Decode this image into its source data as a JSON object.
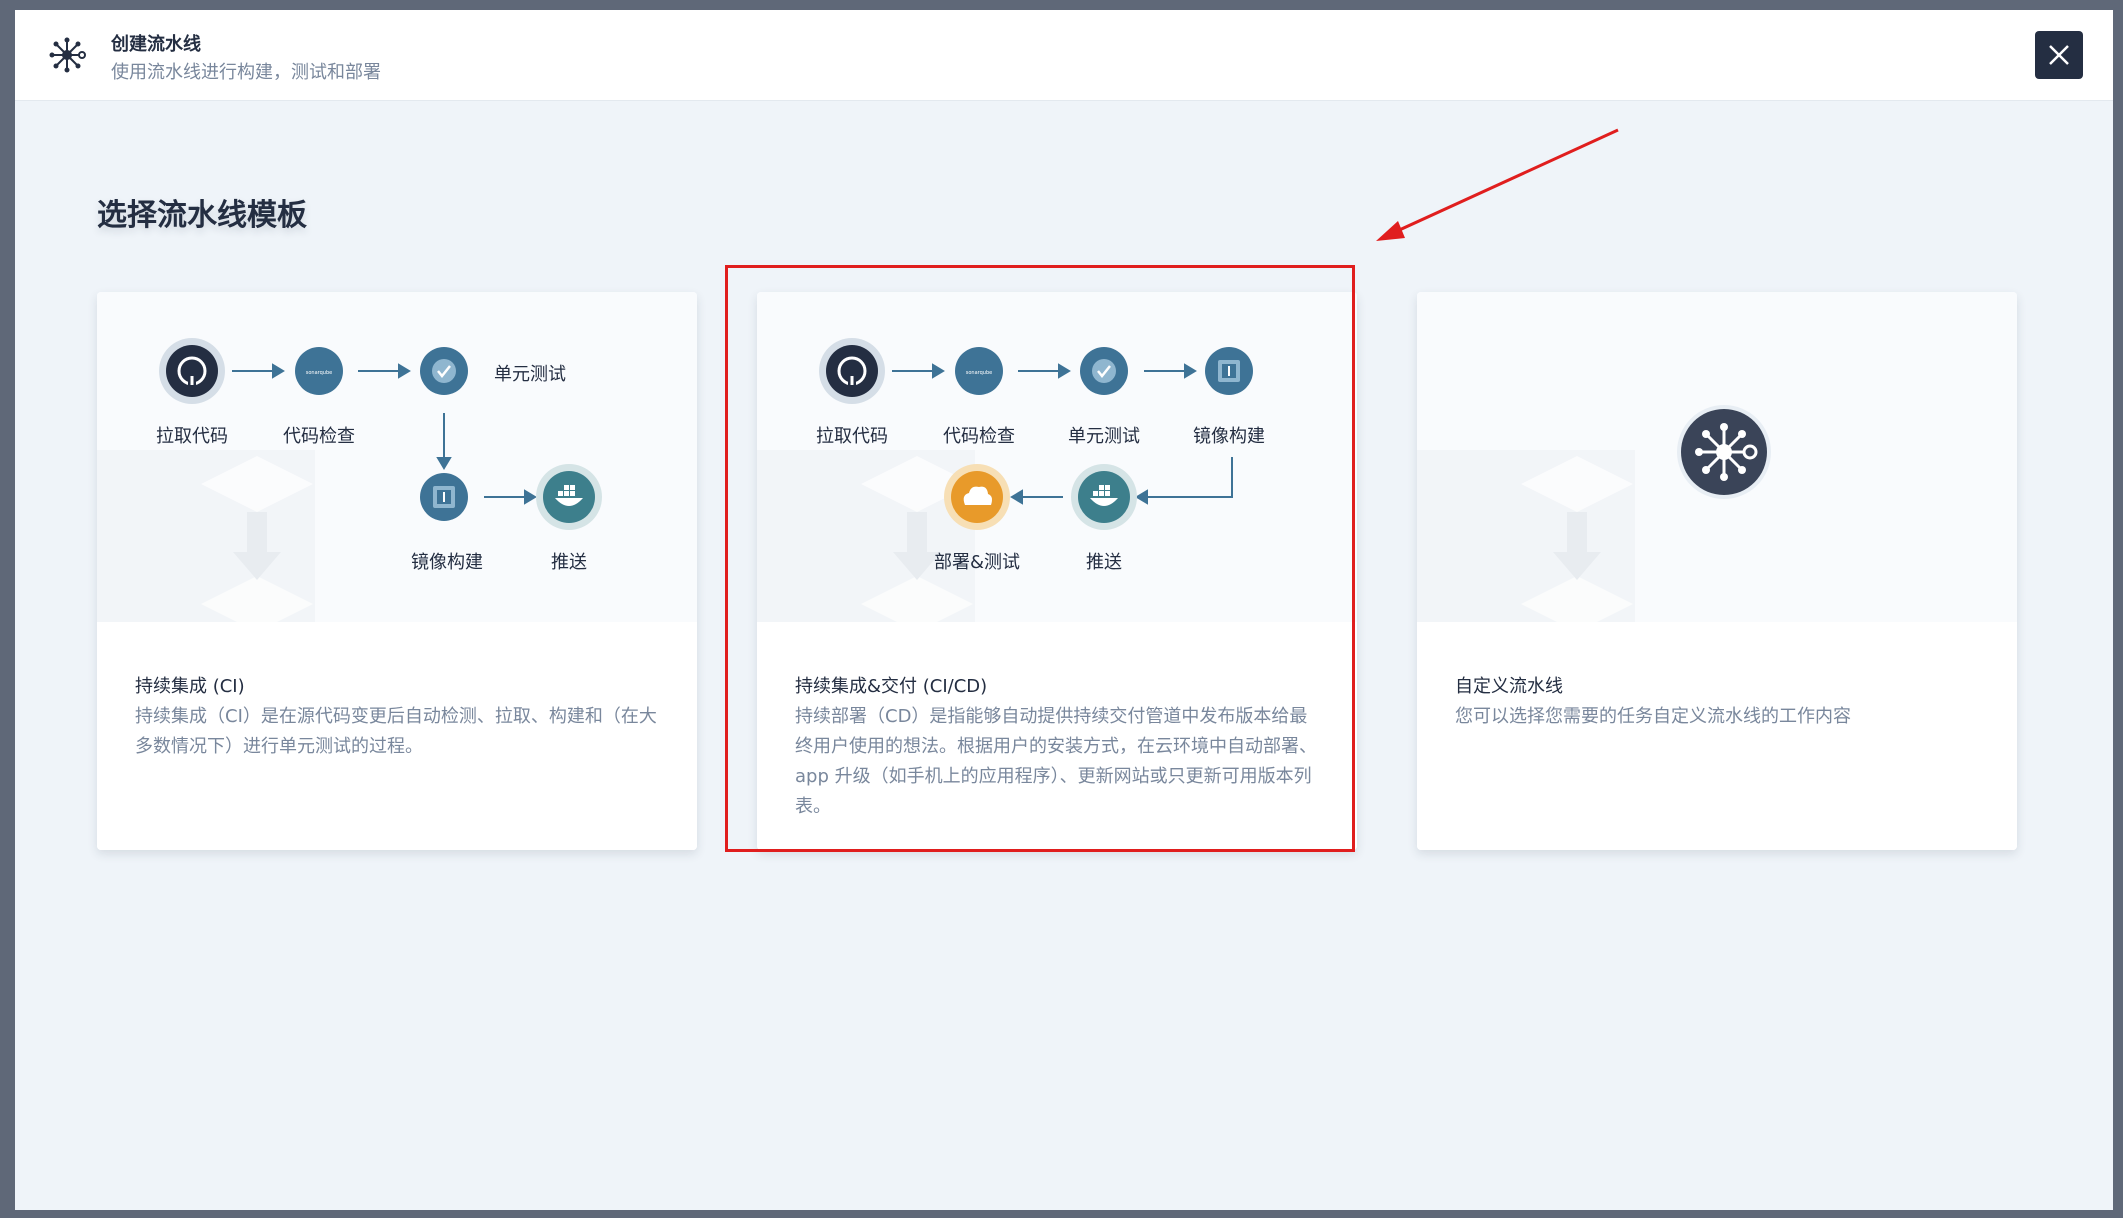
{
  "modal": {
    "title": "创建流水线",
    "description": "使用流水线进行构建，测试和部署",
    "icon": "pipeline-icon",
    "close_icon": "close-icon"
  },
  "page_title": "选择流水线模板",
  "cards": [
    {
      "title": "持续集成 (CI)",
      "description": "持续集成（CI）是在源代码变更后自动检测、拉取、构建和（在大多数情况下）进行单元测试的过程。",
      "steps": [
        "拉取代码",
        "代码检查",
        "单元测试",
        "镜像构建",
        "推送"
      ]
    },
    {
      "title": "持续集成&交付 (CI/CD)",
      "description": "持续部署（CD）是指能够自动提供持续交付管道中发布版本给最终用户使用的想法。根据用户的安装方式，在云环境中自动部署、app 升级（如手机上的应用程序）、更新网站或只更新可用版本列表。",
      "steps": [
        "拉取代码",
        "代码检查",
        "单元测试",
        "镜像构建",
        "推送",
        "部署&测试"
      ]
    },
    {
      "title": "自定义流水线",
      "description": "您可以选择您需要的任务自定义流水线的工作内容"
    }
  ],
  "icons": {
    "pull_code": "github-icon",
    "code_check": "sonarqube-icon",
    "unit_test": "check-icon",
    "image_build": "image-build-icon",
    "push": "docker-icon",
    "deploy_test": "cloud-icon",
    "custom": "pipeline-icon"
  },
  "colors": {
    "dark": "#242e42",
    "step_blue": "#3e7396",
    "docker_teal": "#3d7f8c",
    "deploy_orange": "#e89a2a",
    "highlight_red": "#e01e1e"
  }
}
